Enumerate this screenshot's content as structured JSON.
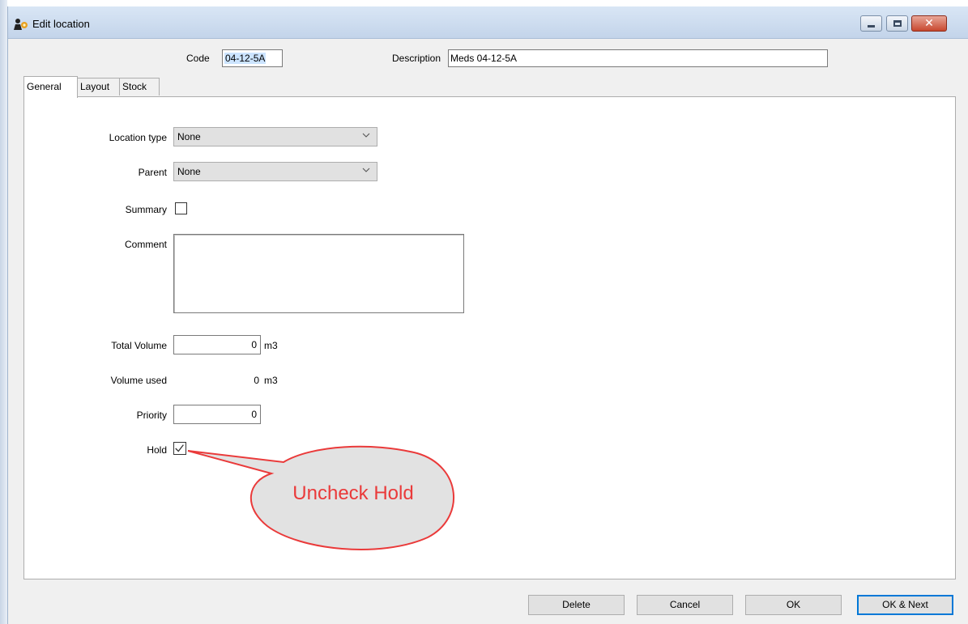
{
  "window": {
    "title": "Edit location",
    "controls": {
      "minimize": "minimize-icon",
      "maximize": "maximize-icon",
      "close": "close-icon"
    }
  },
  "header": {
    "code_label": "Code",
    "code_value": "04-12-5A",
    "description_label": "Description",
    "description_value": "Meds 04-12-5A"
  },
  "tabs": [
    {
      "label": "General",
      "active": true
    },
    {
      "label": "Layout",
      "active": false
    },
    {
      "label": "Stock",
      "active": false
    }
  ],
  "general": {
    "location_type_label": "Location type",
    "location_type_value": "None",
    "parent_label": "Parent",
    "parent_value": "None",
    "summary_label": "Summary",
    "summary_checked": false,
    "comment_label": "Comment",
    "comment_value": "",
    "total_volume_label": "Total Volume",
    "total_volume_value": "0",
    "total_volume_unit": "m3",
    "volume_used_label": "Volume used",
    "volume_used_value": "0",
    "volume_used_unit": "m3",
    "priority_label": "Priority",
    "priority_value": "0",
    "hold_label": "Hold",
    "hold_checked": true
  },
  "callout": {
    "text": "Uncheck Hold",
    "color": "#ea3a3a"
  },
  "buttons": {
    "delete": "Delete",
    "cancel": "Cancel",
    "ok": "OK",
    "ok_next": "OK & Next"
  }
}
